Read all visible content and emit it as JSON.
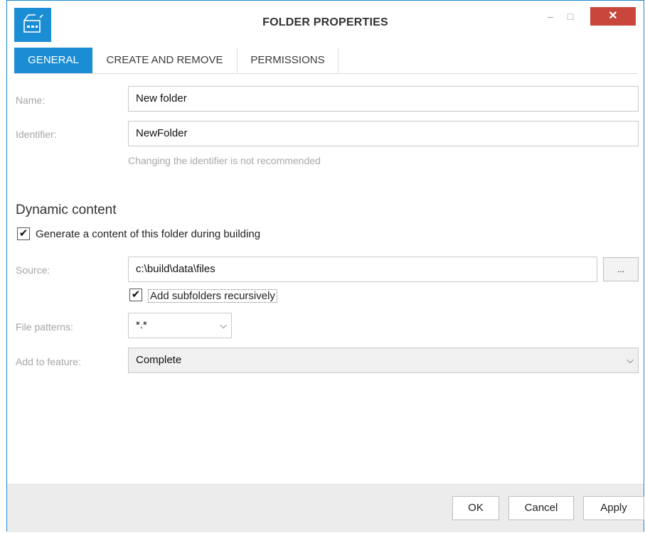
{
  "window": {
    "title": "FOLDER PROPERTIES",
    "min_glyph": "–",
    "max_glyph": "□",
    "close_glyph": "✕"
  },
  "tabs": [
    {
      "label": "GENERAL",
      "active": true
    },
    {
      "label": "CREATE AND REMOVE",
      "active": false
    },
    {
      "label": "PERMISSIONS",
      "active": false
    }
  ],
  "general": {
    "name_label": "Name:",
    "name_value": "New folder",
    "identifier_label": "Identifier:",
    "identifier_value": "NewFolder",
    "identifier_hint": "Changing the identifier is not recommended"
  },
  "dynamic": {
    "heading": "Dynamic content",
    "generate_label": "Generate a content of this folder during building",
    "generate_checked": true,
    "source_label": "Source:",
    "source_value": "c:\\build\\data\\files",
    "browse_label": "...",
    "recursive_label": "Add subfolders recursively",
    "recursive_checked": true,
    "patterns_label": "File patterns:",
    "patterns_value": "*.*",
    "feature_label": "Add to feature:",
    "feature_value": "Complete"
  },
  "footer": {
    "ok_label": "OK",
    "cancel_label": "Cancel",
    "apply_label": "Apply"
  },
  "colors": {
    "accent": "#1b8dd4",
    "close": "#c8463c",
    "footer_bg": "#ececec"
  }
}
